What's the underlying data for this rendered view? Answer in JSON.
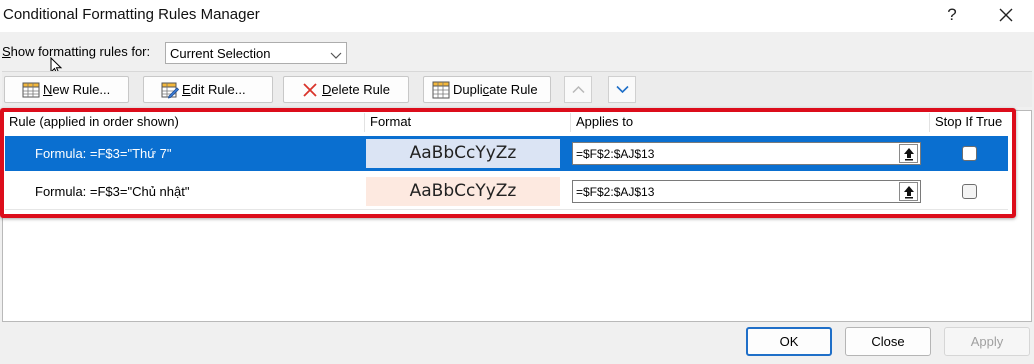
{
  "window": {
    "title": "Conditional Formatting Rules Manager",
    "help_glyph": "?",
    "close_icon": "close-icon"
  },
  "show_rules": {
    "label_prefix": "",
    "label_accel": "S",
    "label_rest": "how formatting rules for:",
    "selected": "Current Selection"
  },
  "toolbar": {
    "new_rule": {
      "accel": "N",
      "rest": "ew Rule...",
      "icon": "table-new-icon"
    },
    "edit_rule": {
      "accel": "E",
      "rest": "dit Rule...",
      "icon": "table-edit-icon"
    },
    "delete_rule": {
      "accel": "D",
      "rest": "elete Rule",
      "icon": "delete-x-icon",
      "accent": "#d9342b"
    },
    "duplicate_rule": {
      "pre": "Dupli",
      "accel": "c",
      "rest": "ate Rule",
      "icon": "table-copy-icon"
    },
    "move_up_icon": "chevron-up-icon",
    "move_down_icon": "chevron-down-icon"
  },
  "table": {
    "headers": [
      "Rule (applied in order shown)",
      "Format",
      "Applies to",
      "Stop If True"
    ],
    "rows": [
      {
        "rule": "Formula: =F$3=\"Thứ 7\"",
        "preview": "AaBbCcYyZz",
        "preview_color": "#dbe4f4",
        "applies_to": "=$F$2:$AJ$13",
        "stop_if_true": false,
        "selected": true
      },
      {
        "rule": "Formula: =F$3=\"Chủ nhật\"",
        "preview": "AaBbCcYyZz",
        "preview_color": "#fde9e0",
        "applies_to": "=$F$2:$AJ$13",
        "stop_if_true": false,
        "selected": false
      }
    ]
  },
  "footer": {
    "ok": "OK",
    "close": "Close",
    "apply": "Apply"
  },
  "colors": {
    "selection": "#0a6fd0",
    "highlight_border": "#dc0d1b",
    "default_button_border": "#1f6fc8"
  }
}
